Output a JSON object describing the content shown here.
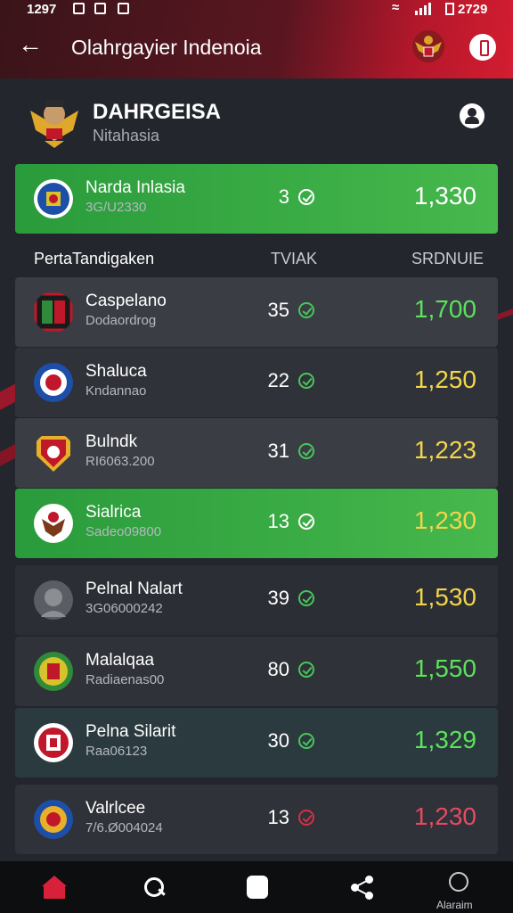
{
  "status_bar": {
    "time": "1297",
    "clock": "2729"
  },
  "header": {
    "title": "Olahrgayier Indenoia"
  },
  "profile": {
    "name": "DAHRGEISA",
    "subtitle": "Nitahasia"
  },
  "top_card": {
    "name": "Narda Inlasia",
    "sub": "3G/U2330",
    "num": "3",
    "score": "1,330"
  },
  "columns": {
    "left": "PertaTandigaken",
    "mid": "TVIAK",
    "right": "SRDNUIE"
  },
  "rows": [
    {
      "name": "Caspelano",
      "sub": "Dodaordrog",
      "num": "35",
      "score": "1,700",
      "score_color": "green",
      "bg": "dark1"
    },
    {
      "name": "Shaluca",
      "sub": "Kndannao",
      "num": "22",
      "score": "1,250",
      "score_color": "yellow",
      "bg": "dark2"
    },
    {
      "name": "Bulndk",
      "sub": "RI6063.200",
      "num": "31",
      "score": "1,223",
      "score_color": "yellow",
      "bg": "dark1"
    },
    {
      "name": "Sialrica",
      "sub": "Sadeo09800",
      "num": "13",
      "score": "1,230",
      "score_color": "yellow",
      "bg": "green"
    },
    {
      "name": "Pelnal Nalart",
      "sub": "3G06000242",
      "num": "39",
      "score": "1,530",
      "score_color": "yellow",
      "bg": "dark3"
    },
    {
      "name": "Malalqaa",
      "sub": "Radiaenas00",
      "num": "80",
      "score": "1,550",
      "score_color": "green",
      "bg": "dark2"
    },
    {
      "name": "Pelna Silarit",
      "sub": "Raa06123",
      "num": "30",
      "score": "1,329",
      "score_color": "green",
      "bg": "teal"
    },
    {
      "name": "Valrlcee",
      "sub": "7/6.Ø004024",
      "num": "13",
      "score": "1,230",
      "score_color": "red",
      "bg": "dark2"
    }
  ],
  "bottom_nav": {
    "alarm_label": "Alaraim"
  },
  "colors": {
    "accent": "#c0172b",
    "green": "#3fae45",
    "yellow": "#f3d54a",
    "red": "#e64a62"
  }
}
